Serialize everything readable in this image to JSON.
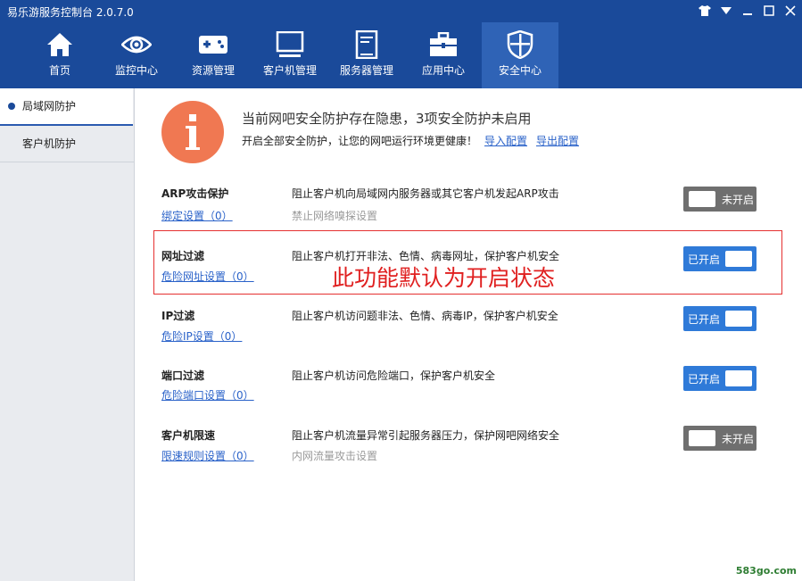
{
  "app": {
    "title": "易乐游服务控制台 2.0.7.0"
  },
  "window_controls": [
    {
      "name": "shirt-icon"
    },
    {
      "name": "dropdown-icon"
    },
    {
      "name": "minimize-icon"
    },
    {
      "name": "maximize-icon"
    },
    {
      "name": "close-icon"
    }
  ],
  "nav": {
    "items": [
      {
        "label": "首页",
        "icon": "home-icon"
      },
      {
        "label": "监控中心",
        "icon": "eye-icon"
      },
      {
        "label": "资源管理",
        "icon": "gamepad-icon"
      },
      {
        "label": "客户机管理",
        "icon": "monitor-icon"
      },
      {
        "label": "服务器管理",
        "icon": "server-icon"
      },
      {
        "label": "应用中心",
        "icon": "toolbox-icon"
      },
      {
        "label": "安全中心",
        "icon": "shield-icon",
        "active": true
      }
    ]
  },
  "sidebar": {
    "items": [
      {
        "label": "局域网防护",
        "active": true
      },
      {
        "label": "客户机防护"
      }
    ]
  },
  "alert": {
    "title": "当前网吧安全防护存在隐患，3项安全防护未启用",
    "subtitle": "开启全部安全防护，让您的网吧运行环境更健康！",
    "import_link": "导入配置",
    "export_link": "导出配置"
  },
  "rows": [
    {
      "title": "ARP攻击保护",
      "link": "绑定设置（0）",
      "desc": "阻止客户机向局域网内服务器或其它客户机发起ARP攻击",
      "sub": "禁止网络嗅探设置",
      "toggle_label": "未开启",
      "on": false
    },
    {
      "title": "网址过滤",
      "link": "危险网址设置（0）",
      "desc": "阻止客户机打开非法、色情、病毒网址，保护客户机安全",
      "sub": "",
      "toggle_label": "已开启",
      "on": true
    },
    {
      "title": "IP过滤",
      "link": "危险IP设置（0）",
      "desc": "阻止客户机访问题非法、色情、病毒IP，保护客户机安全",
      "sub": "",
      "toggle_label": "已开启",
      "on": true
    },
    {
      "title": "端口过滤",
      "link": "危险端口设置（0）",
      "desc": "阻止客户机访问危险端口，保护客户机安全",
      "sub": "",
      "toggle_label": "已开启",
      "on": true
    },
    {
      "title": "客户机限速",
      "link": "限速规则设置（0）",
      "desc": "阻止客户机流量异常引起服务器压力，保护网吧网络安全",
      "sub": "内网流量攻击设置",
      "toggle_label": "未开启",
      "on": false
    }
  ],
  "annotation": "此功能默认为开启状态",
  "watermark": "583go.com",
  "colors": {
    "header": "#1a4a9a",
    "active_tab": "#2f63b6",
    "toggle_on": "#2f7ad8",
    "toggle_off": "#6f6f6f",
    "alert": "#f07852",
    "annotation": "#e02020"
  }
}
